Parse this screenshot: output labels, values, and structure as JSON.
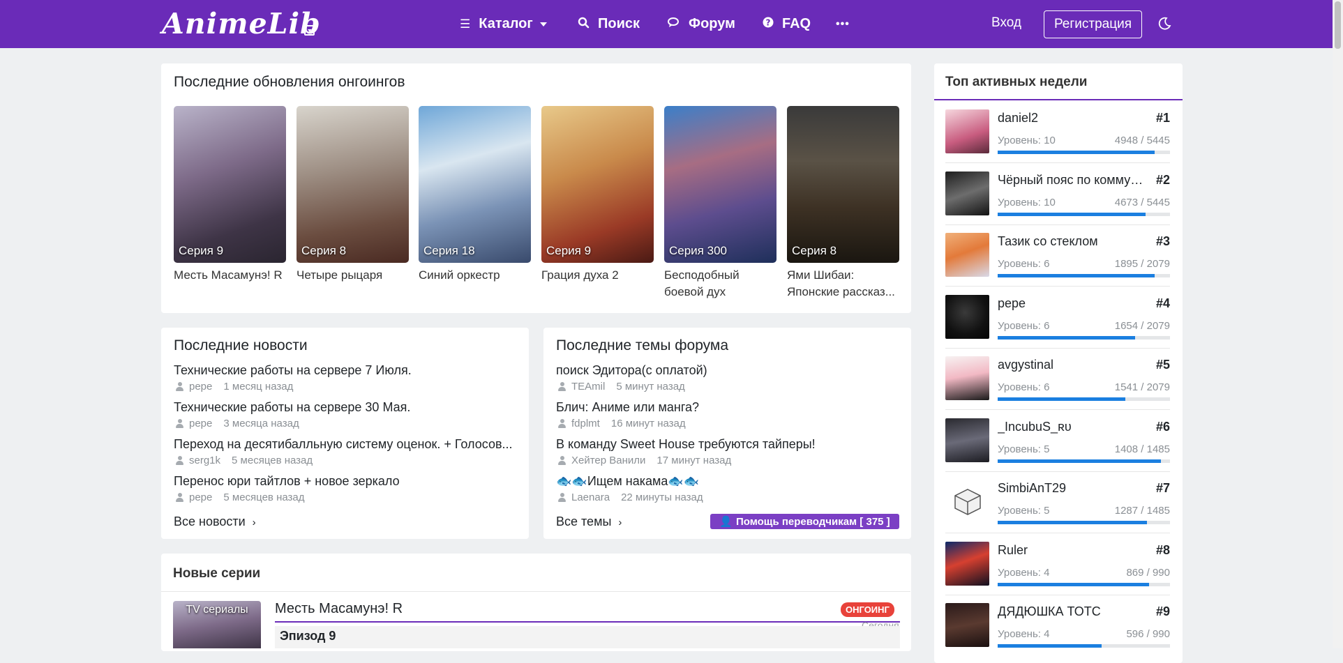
{
  "header": {
    "logo": "AnimeLib",
    "nav": [
      {
        "label": "Каталог",
        "icon": "menu-icon"
      },
      {
        "label": "Поиск",
        "icon": "search-icon"
      },
      {
        "label": "Форум",
        "icon": "chat-icon"
      },
      {
        "label": "FAQ",
        "icon": "question-icon"
      }
    ],
    "more": "•••",
    "login": "Вход",
    "register": "Регистрация"
  },
  "ongoing": {
    "title": "Последние обновления онгоингов",
    "items": [
      {
        "episode": "Серия 9",
        "name": "Месть Масамунэ! R"
      },
      {
        "episode": "Серия 8",
        "name": "Четыре рыцаря"
      },
      {
        "episode": "Серия 18",
        "name": "Синий оркестр"
      },
      {
        "episode": "Серия 9",
        "name": "Грация духа 2"
      },
      {
        "episode": "Серия 300",
        "name": "Бесподобный боевой дух"
      },
      {
        "episode": "Серия 8",
        "name": "Ями Шибаи: Японские рассказ..."
      }
    ]
  },
  "news": {
    "title": "Последние новости",
    "items": [
      {
        "title": "Технические работы на сервере 7 Июля.",
        "user": "pepe",
        "time": "1 месяц назад"
      },
      {
        "title": "Технические работы на сервере 30 Мая.",
        "user": "pepe",
        "time": "3 месяца назад"
      },
      {
        "title": "Переход на десятибалльную систему оценок. + Голосов...",
        "user": "serg1k",
        "time": "5 месяцев назад"
      },
      {
        "title": "Перенос юри тайтлов + новое зеркало",
        "user": "pepe",
        "time": "5 месяцев назад"
      }
    ],
    "all_link": "Все новости"
  },
  "forum": {
    "title": "Последние темы форума",
    "items": [
      {
        "title": "поиск Эдитора(с оплатой)",
        "user": "TEAmil",
        "time": "5 минут назад"
      },
      {
        "title": "Блич: Аниме или манга?",
        "user": "fdplmt",
        "time": "16 минут назад"
      },
      {
        "title": "В команду Sweet House требуются тайперы!",
        "user": "Хейтер Ванили",
        "time": "17 минут назад"
      },
      {
        "title": "🐟🐟Ищем накама🐟🐟",
        "user": "Laenara",
        "time": "22 минуты назад"
      }
    ],
    "all_link": "Все темы",
    "help_badge": "Помощь переводчикам [ 375 ]"
  },
  "top_users": {
    "title": "Топ активных недели",
    "users": [
      {
        "name": "daniel2",
        "rank": "#1",
        "level": "Уровень: 10",
        "xp": "4948 / 5445",
        "progress": 0.909
      },
      {
        "name": "Чёрный пояс по коммуникации",
        "rank": "#2",
        "level": "Уровень: 10",
        "xp": "4673 / 5445",
        "progress": 0.858
      },
      {
        "name": "Тазик со стеклом",
        "rank": "#3",
        "level": "Уровень: 6",
        "xp": "1895 / 2079",
        "progress": 0.911
      },
      {
        "name": "pepe",
        "rank": "#4",
        "level": "Уровень: 6",
        "xp": "1654 / 2079",
        "progress": 0.796
      },
      {
        "name": "avgystinal",
        "rank": "#5",
        "level": "Уровень: 6",
        "xp": "1541 / 2079",
        "progress": 0.741
      },
      {
        "name": "_IncubuS_ʀᴜ",
        "rank": "#6",
        "level": "Уровень: 5",
        "xp": "1408 / 1485",
        "progress": 0.948
      },
      {
        "name": "SimbiAnT29",
        "rank": "#7",
        "level": "Уровень: 5",
        "xp": "1287 / 1485",
        "progress": 0.867
      },
      {
        "name": "Ruler",
        "rank": "#8",
        "level": "Уровень: 4",
        "xp": "869 / 990",
        "progress": 0.878
      },
      {
        "name": "ДЯДЮШКА ТОТС",
        "rank": "#9",
        "level": "Уровень: 4",
        "xp": "596 / 990",
        "progress": 0.602
      }
    ]
  },
  "new_episodes": {
    "title": "Новые серии",
    "first": {
      "category": "TV сериалы",
      "title": "Месть Масамунэ! R",
      "status": "ОНГОИНГ",
      "time": "Сегодня",
      "episode": "Эпизод 9"
    }
  },
  "colors": {
    "brand": "#6a2bb8",
    "progress": "#1b7fe0",
    "badge": "#e8423a"
  }
}
